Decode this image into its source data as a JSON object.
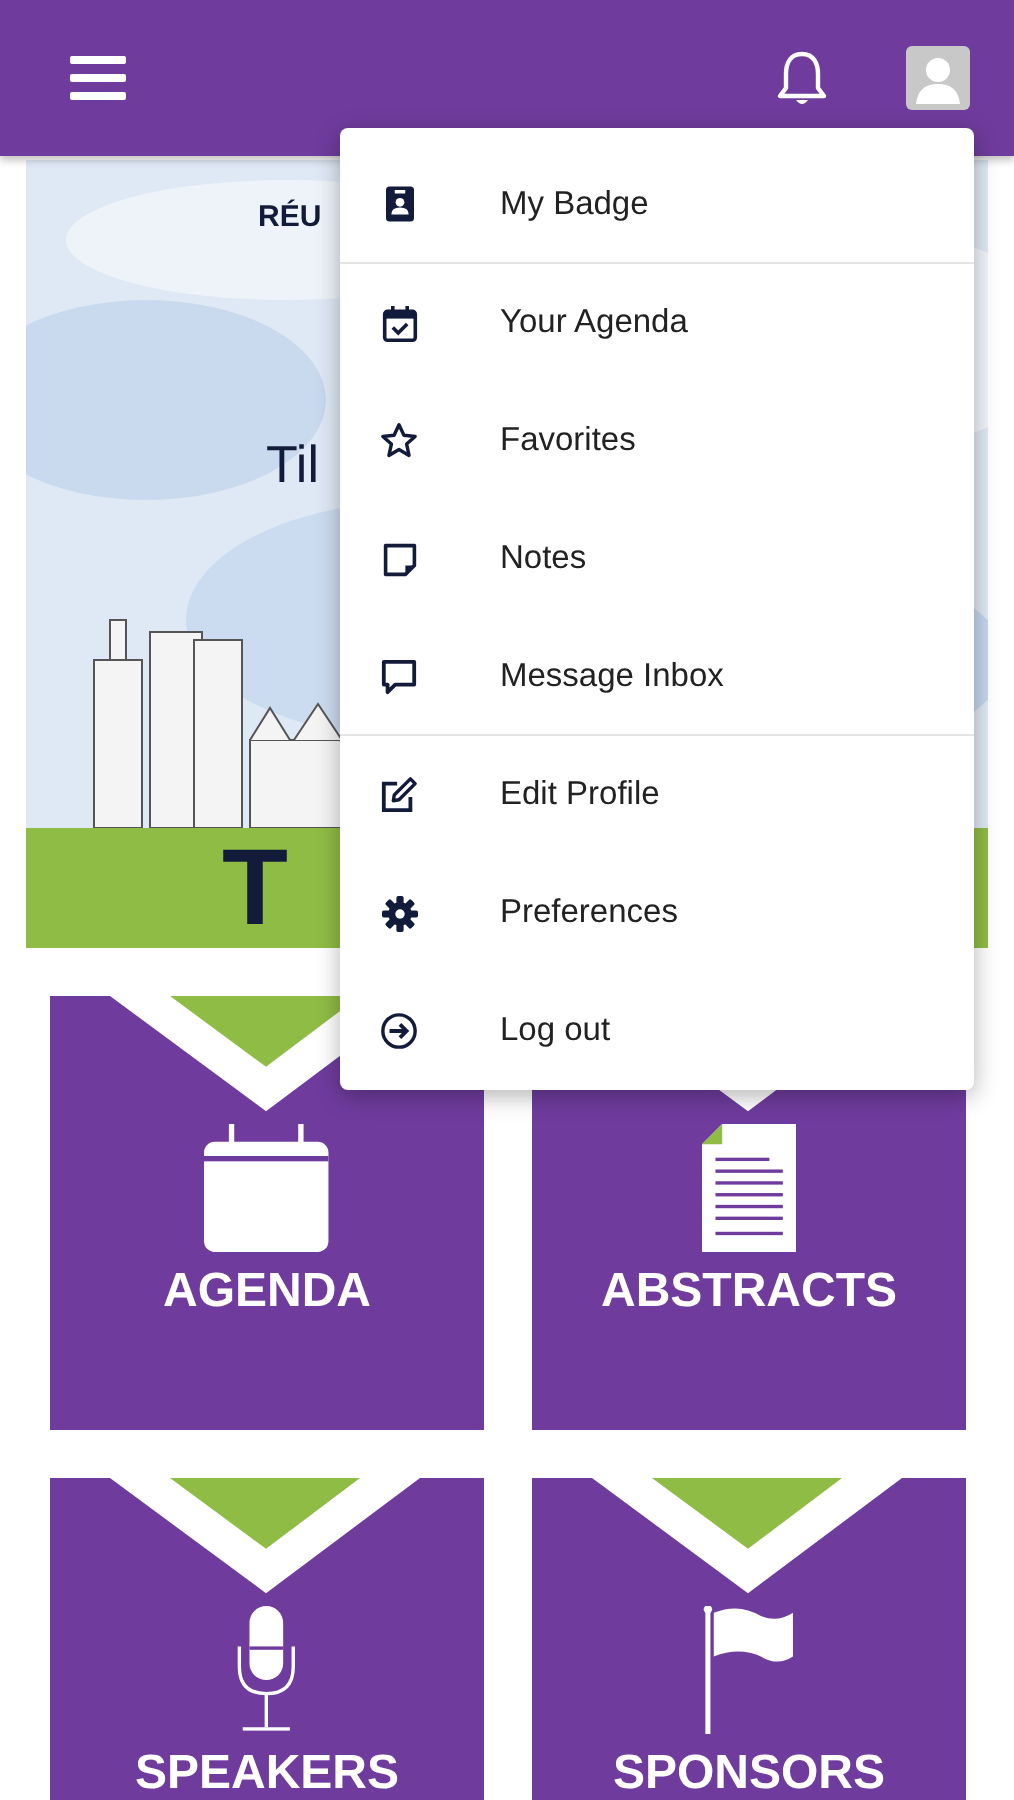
{
  "banner": {
    "kicker": "RÉU",
    "subtitle": "Til",
    "city": "T"
  },
  "tiles": [
    {
      "label": "AGENDA",
      "kind": "calendar"
    },
    {
      "label": "ABSTRACTS",
      "kind": "document"
    },
    {
      "label": "SPEAKERS",
      "kind": "microphone"
    },
    {
      "label": "SPONSORS",
      "kind": "flag"
    }
  ],
  "user_menu": {
    "items": [
      {
        "label": "My Badge",
        "kind": "badge",
        "divider_after": true
      },
      {
        "label": "Your Agenda",
        "kind": "agenda",
        "divider_after": false
      },
      {
        "label": "Favorites",
        "kind": "star",
        "divider_after": false
      },
      {
        "label": "Notes",
        "kind": "note",
        "divider_after": false
      },
      {
        "label": "Message Inbox",
        "kind": "message",
        "divider_after": true
      },
      {
        "label": "Edit Profile",
        "kind": "edit",
        "divider_after": false
      },
      {
        "label": "Preferences",
        "kind": "gear",
        "divider_after": false
      },
      {
        "label": "Log out",
        "kind": "logout",
        "divider_after": false
      }
    ]
  }
}
